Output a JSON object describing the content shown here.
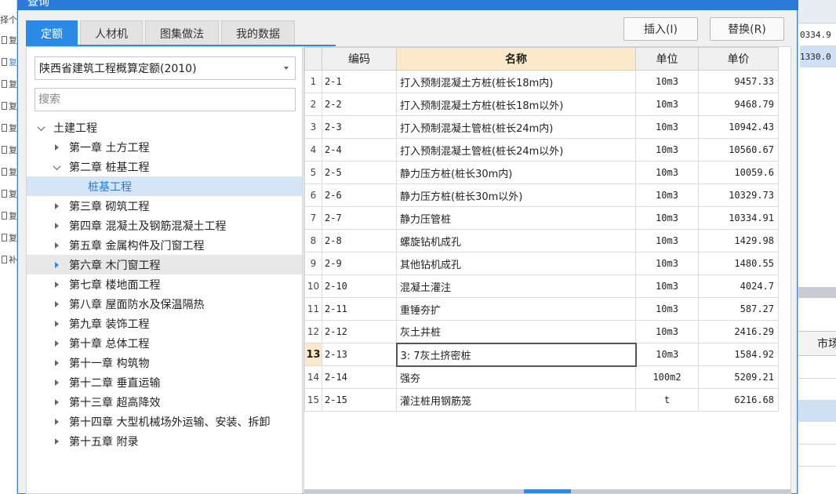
{
  "window": {
    "title": "查询"
  },
  "tabs": [
    {
      "label": "定额",
      "active": true
    },
    {
      "label": "人材机",
      "active": false
    },
    {
      "label": "图集做法",
      "active": false
    },
    {
      "label": "我的数据",
      "active": false
    }
  ],
  "toolbar": {
    "insert_label": "插入(I)",
    "replace_label": "替换(R)"
  },
  "quota_library": {
    "selected": "陕西省建筑工程概算定额(2010)"
  },
  "search": {
    "placeholder": "搜索"
  },
  "tree": [
    {
      "label": "土建工程",
      "level": 0,
      "expanded": true
    },
    {
      "label": "第一章 土方工程",
      "level": 1,
      "expanded": false
    },
    {
      "label": "第二章 桩基工程",
      "level": 1,
      "expanded": true
    },
    {
      "label": "桩基工程",
      "level": 2,
      "selected": true
    },
    {
      "label": "第三章 砌筑工程",
      "level": 1,
      "expanded": false
    },
    {
      "label": "第四章 混凝土及钢筋混凝土工程",
      "level": 1,
      "expanded": false
    },
    {
      "label": "第五章 金属构件及门窗工程",
      "level": 1,
      "expanded": false
    },
    {
      "label": "第六章 木门窗工程",
      "level": 1,
      "expanded": false,
      "hovered": true
    },
    {
      "label": "第七章 楼地面工程",
      "level": 1,
      "expanded": false
    },
    {
      "label": "第八章 屋面防水及保温隔热",
      "level": 1,
      "expanded": false
    },
    {
      "label": "第九章 装饰工程",
      "level": 1,
      "expanded": false
    },
    {
      "label": "第十章 总体工程",
      "level": 1,
      "expanded": false
    },
    {
      "label": "第十一章 构筑物",
      "level": 1,
      "expanded": false
    },
    {
      "label": "第十二章 垂直运输",
      "level": 1,
      "expanded": false
    },
    {
      "label": "第十三章 超高降效",
      "level": 1,
      "expanded": false
    },
    {
      "label": "第十四章 大型机械场外运输、安装、拆卸",
      "level": 1,
      "expanded": false
    },
    {
      "label": "第十五章 附录",
      "level": 1,
      "expanded": false
    }
  ],
  "table": {
    "columns": [
      "编码",
      "名称",
      "单位",
      "单价"
    ],
    "active_row": 13,
    "rows": [
      {
        "num": "1",
        "code": "2-1",
        "name": "打入预制混凝土方桩(桩长18m内)",
        "unit": "10m3",
        "price": "9457.33"
      },
      {
        "num": "2",
        "code": "2-2",
        "name": "打入预制混凝土方桩(桩长18m以外)",
        "unit": "10m3",
        "price": "9468.79"
      },
      {
        "num": "3",
        "code": "2-3",
        "name": "打入预制混凝土管桩(桩长24m内)",
        "unit": "10m3",
        "price": "10942.43"
      },
      {
        "num": "4",
        "code": "2-4",
        "name": "打入预制混凝土管桩(桩长24m以外)",
        "unit": "10m3",
        "price": "10560.67"
      },
      {
        "num": "5",
        "code": "2-5",
        "name": "静力压方桩(桩长30m内)",
        "unit": "10m3",
        "price": "10059.6"
      },
      {
        "num": "6",
        "code": "2-6",
        "name": "静力压方桩(桩长30m以外)",
        "unit": "10m3",
        "price": "10329.73"
      },
      {
        "num": "7",
        "code": "2-7",
        "name": "静力压管桩",
        "unit": "10m3",
        "price": "10334.91"
      },
      {
        "num": "8",
        "code": "2-8",
        "name": "螺旋钻机成孔",
        "unit": "10m3",
        "price": "1429.98"
      },
      {
        "num": "9",
        "code": "2-9",
        "name": "其他钻机成孔",
        "unit": "10m3",
        "price": "1480.55"
      },
      {
        "num": "10",
        "code": "2-10",
        "name": "混凝土灌注",
        "unit": "10m3",
        "price": "4024.7"
      },
      {
        "num": "11",
        "code": "2-11",
        "name": "重锤夯扩",
        "unit": "10m3",
        "price": "587.27"
      },
      {
        "num": "12",
        "code": "2-12",
        "name": "灰土井桩",
        "unit": "10m3",
        "price": "2416.29"
      },
      {
        "num": "13",
        "code": "2-13",
        "name": "3: 7灰土挤密桩",
        "unit": "10m3",
        "price": "1584.92"
      },
      {
        "num": "14",
        "code": "2-14",
        "name": "强夯",
        "unit": "100m2",
        "price": "5209.21"
      },
      {
        "num": "15",
        "code": "2-15",
        "name": "灌注桩用钢筋笼",
        "unit": "t",
        "price": "6216.68"
      }
    ]
  },
  "background_left": {
    "header": "择个",
    "row_glyph": "复",
    "last_glyph": "补"
  },
  "background_right": {
    "values": [
      "0334.9",
      "1330.0"
    ],
    "column_header": "市场"
  },
  "colors": {
    "accent": "#2b8ae6",
    "header_highlight": "#fce9c9",
    "selected_tree": "#d5e5f8"
  }
}
